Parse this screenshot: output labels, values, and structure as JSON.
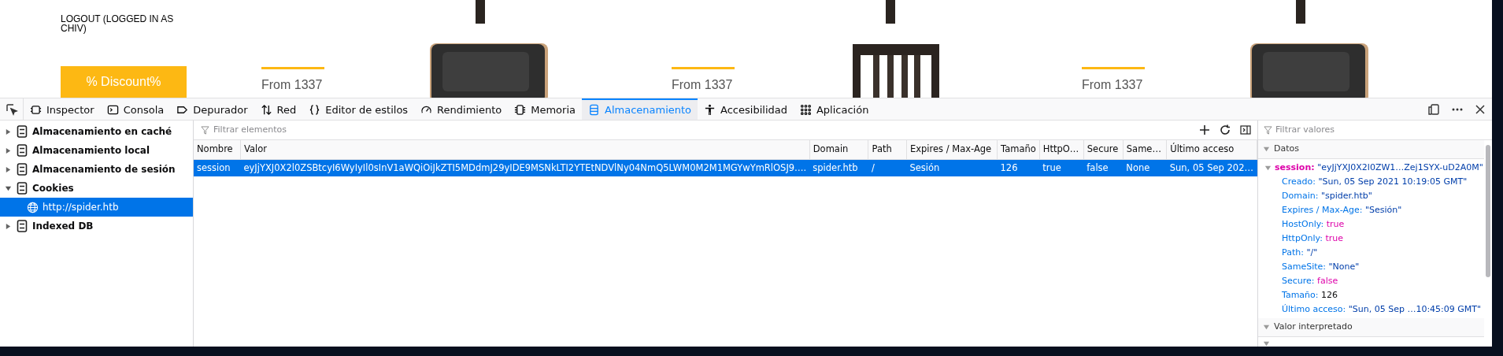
{
  "webpage": {
    "logout": "LOGOUT (LOGGED IN AS CHIV)",
    "discount_button": "% Discount%",
    "products": [
      {
        "kind": "picture",
        "price": "From 1337"
      },
      {
        "kind": "picture",
        "price": "From 1337"
      },
      {
        "kind": "picture",
        "price": "From 1337"
      }
    ]
  },
  "devtools": {
    "tools": [
      {
        "label": "Inspector",
        "selected": false
      },
      {
        "label": "Consola",
        "selected": false
      },
      {
        "label": "Depurador",
        "selected": false
      },
      {
        "label": "Red",
        "selected": false
      },
      {
        "label": "Editor de estilos",
        "selected": false
      },
      {
        "label": "Rendimiento",
        "selected": false
      },
      {
        "label": "Memoria",
        "selected": false
      },
      {
        "label": "Almacenamiento",
        "selected": true
      },
      {
        "label": "Accesibilidad",
        "selected": false
      },
      {
        "label": "Aplicación",
        "selected": false
      }
    ],
    "sidebar": [
      {
        "label": "Almacenamiento en caché",
        "expanded": false,
        "selected": false
      },
      {
        "label": "Almacenamiento local",
        "expanded": false,
        "selected": false
      },
      {
        "label": "Almacenamiento de sesión",
        "expanded": false,
        "selected": false
      },
      {
        "label": "Cookies",
        "expanded": true,
        "selected": false,
        "children": [
          {
            "label": "http://spider.htb",
            "selected": true
          }
        ]
      },
      {
        "label": "Indexed DB",
        "expanded": false,
        "selected": false
      }
    ],
    "filter": {
      "placeholder": "Filtrar elementos"
    },
    "table": {
      "columns": [
        "Nombre",
        "Valor",
        "Domain",
        "Path",
        "Expires / Max-Age",
        "Tamaño",
        "HttpO…",
        "Secure",
        "Same…",
        "Último acceso"
      ],
      "rows": [
        {
          "selected": true,
          "cells": [
            "session",
            "eyJjYXJ0X2l0ZSBtcyI6WyIyIl0sInV1aWQiOiJkZTI5MDdmJ29yIDE9MSNkLTI2YTEtNDVlNy04NmQ5LWM0M2M1MGYwYmRlOSJ9….",
            "spider.htb",
            "/",
            "Sesión",
            "126",
            "true",
            "false",
            "None",
            "Sun, 05 Sep 202…"
          ]
        }
      ]
    },
    "details": {
      "filter": {
        "placeholder": "Filtrar valores"
      },
      "sections": [
        {
          "title": "Datos",
          "expanded": true
        },
        {
          "title": "Valor interpretado",
          "expanded": true
        }
      ],
      "entry": {
        "name": "session:",
        "value": "\"eyJjYXJ0X2l0ZW1…Zej1SYX-uD2A0M\"",
        "expanded": true
      },
      "props": [
        {
          "key": "Creado:",
          "value": "\"Sun, 05 Sep 2021 10:19:05 GMT\"",
          "kind": "string"
        },
        {
          "key": "Domain:",
          "value": "\"spider.htb\"",
          "kind": "string"
        },
        {
          "key": "Expires / Max-Age:",
          "value": "\"Sesión\"",
          "kind": "string"
        },
        {
          "key": "HostOnly:",
          "value": "true",
          "kind": "bool"
        },
        {
          "key": "HttpOnly:",
          "value": "true",
          "kind": "bool"
        },
        {
          "key": "Path:",
          "value": "\"/\"",
          "kind": "string"
        },
        {
          "key": "SameSite:",
          "value": "\"None\"",
          "kind": "string"
        },
        {
          "key": "Secure:",
          "value": "false",
          "kind": "bool"
        },
        {
          "key": "Tamaño:",
          "value": "126",
          "kind": "number"
        },
        {
          "key": "Último acceso:",
          "value": "\"Sun, 05 Sep …10:45:09 GMT\"",
          "kind": "string"
        }
      ]
    }
  }
}
